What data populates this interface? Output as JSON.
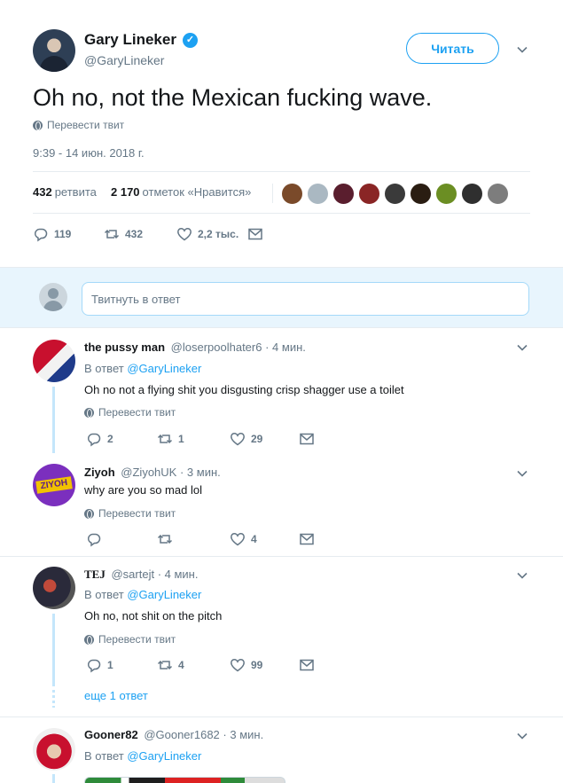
{
  "tweet": {
    "display_name": "Gary Lineker",
    "handle": "@GaryLineker",
    "follow_label": "Читать",
    "text": "Oh no, not the Mexican fucking wave.",
    "translate_label": "Перевести твит",
    "timestamp": "9:39 - 14 июн. 2018 г.",
    "retweets_count": "432",
    "retweets_label": "ретвита",
    "likes_count": "2 170",
    "likes_label": "отметок «Нравится»",
    "actions": {
      "replies": "119",
      "retweets": "432",
      "likes": "2,2 тыс."
    },
    "liker_colors": [
      "#7a4a2a",
      "#aab8c2",
      "#5a1e2e",
      "#8a2525",
      "#3a3a3a",
      "#2a1d12",
      "#6b8e23",
      "#2f2f2f",
      "#7d7d7d"
    ]
  },
  "composer": {
    "placeholder": "Твитнуть в ответ"
  },
  "replies": [
    {
      "name": "the pussy man",
      "handle": "@loserpoolhater6",
      "time": "· 4 мин.",
      "in_reply_prefix": "В ответ",
      "in_reply_to": "@GaryLineker",
      "text": "Oh no not a flying shit you disgusting crisp shagger use a toilet",
      "translate_label": "Перевести твит",
      "replies": "2",
      "retweets": "1",
      "likes": "29"
    },
    {
      "name": "Ziyoh",
      "handle": "@ZiyohUK",
      "time": "· 3 мин.",
      "text": "why are you so mad lol",
      "translate_label": "Перевести твит",
      "replies": "",
      "retweets": "",
      "likes": "4",
      "avatar_text": "ZIYOH"
    },
    {
      "name": "TEJ",
      "handle": "@sartejt",
      "time": "· 4 мин.",
      "in_reply_prefix": "В ответ",
      "in_reply_to": "@GaryLineker",
      "text": "Oh no, not shit on the pitch",
      "translate_label": "Перевести твит",
      "replies": "1",
      "retweets": "4",
      "likes": "99",
      "more_replies": "еще 1 ответ"
    },
    {
      "name": "Gooner82",
      "handle": "@Gooner1682",
      "time": "· 3 мин.",
      "in_reply_prefix": "В ответ",
      "in_reply_to": "@GaryLineker"
    }
  ],
  "colors": {
    "accent": "#1da1f2",
    "muted": "#657786",
    "thread_line": "#c4e6fb",
    "composer_bg": "#e8f5fd"
  }
}
